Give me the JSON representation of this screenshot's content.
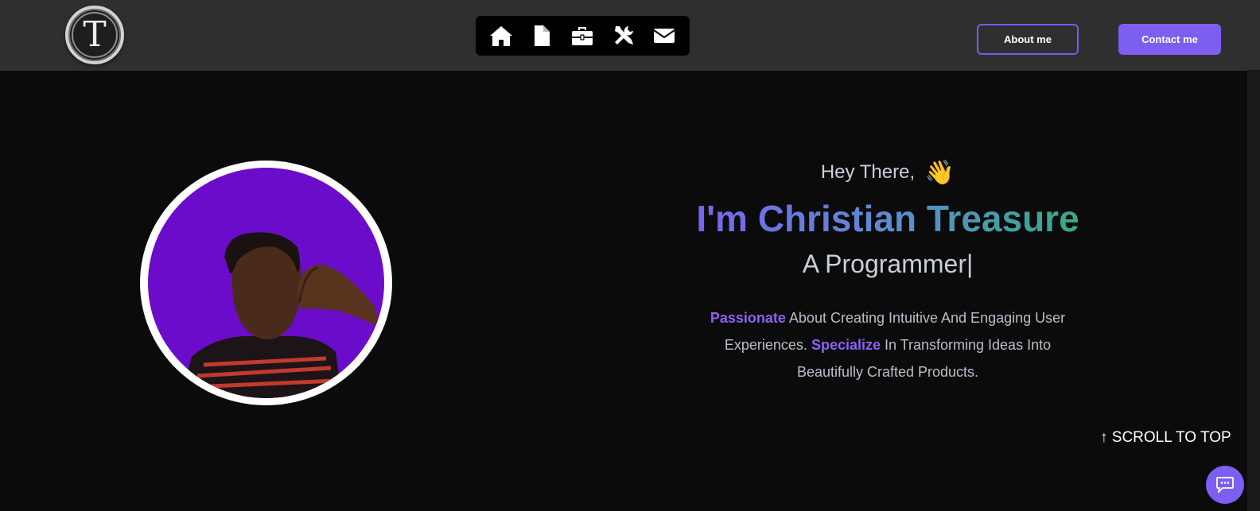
{
  "header": {
    "logo": {
      "letter": "T",
      "icon": "logo-t-icon"
    },
    "nav": [
      {
        "icon": "home-icon"
      },
      {
        "icon": "document-icon"
      },
      {
        "icon": "briefcase-icon"
      },
      {
        "icon": "tools-icon"
      },
      {
        "icon": "envelope-icon"
      }
    ],
    "about_label": "About me",
    "contact_label": "Contact me"
  },
  "hero": {
    "greeting": "Hey There,",
    "wave": "👋",
    "name": "I'm Christian Treasure",
    "role": "A Programmer|",
    "desc_1_accent": "Passionate",
    "desc_2": " About Creating Intuitive And Engaging User Experiences. ",
    "desc_3_accent": "Specialize",
    "desc_4": " In Transforming Ideas Into Beautifully Crafted Products."
  },
  "scroll_top_label": "↑ SCROLL TO TOP",
  "colors": {
    "accent": "#7c5ff0",
    "background": "#0b0b0b",
    "header": "#2f2f2f",
    "avatar_bg": "#6a0cc9"
  }
}
